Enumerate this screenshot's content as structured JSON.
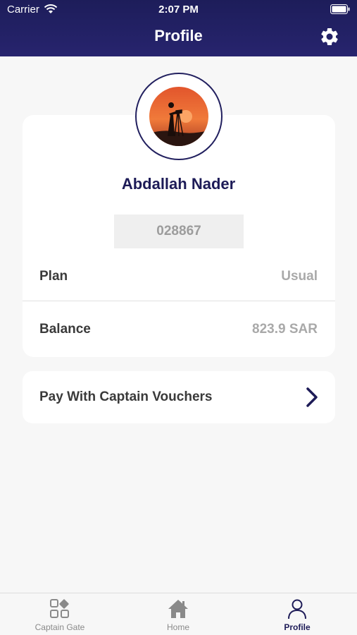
{
  "status_bar": {
    "carrier": "Carrier",
    "time": "2:07 PM"
  },
  "header": {
    "title": "Profile",
    "settings_icon": "gear-icon"
  },
  "profile": {
    "name": "Abdallah Nader",
    "code": "028867",
    "plan_label": "Plan",
    "plan_value": "Usual",
    "balance_label": "Balance",
    "balance_value": "823.9 SAR"
  },
  "voucher": {
    "label": "Pay With Captain Vouchers",
    "icon": "chevron-right-icon"
  },
  "tabs": [
    {
      "label": "Captain Gate",
      "icon": "grid-icon",
      "active": false
    },
    {
      "label": "Home",
      "icon": "home-icon",
      "active": false
    },
    {
      "label": "Profile",
      "icon": "user-icon",
      "active": true
    }
  ],
  "colors": {
    "header": "#1d1d5a",
    "accent": "#1d1b57",
    "background": "#f7f7f7"
  }
}
